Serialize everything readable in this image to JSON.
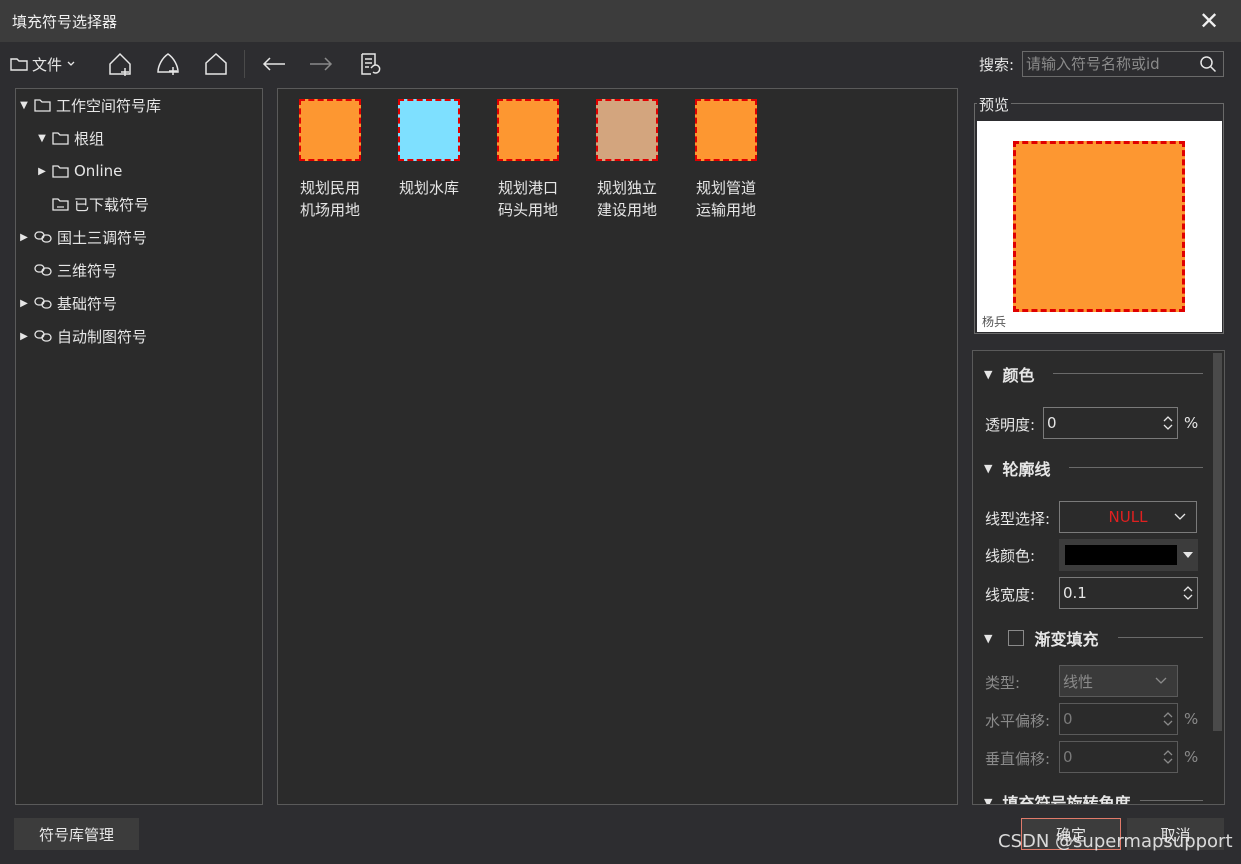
{
  "window": {
    "title": "填充符号选择器",
    "close_label": "✕"
  },
  "toolbar": {
    "file_label": "文件",
    "search_label": "搜索:",
    "search_placeholder": "请输入符号名称或id"
  },
  "tree": {
    "items": [
      {
        "label": "工作空间符号库",
        "expanded": true,
        "icon": "folder-icon"
      },
      {
        "label": "根组",
        "expanded": true,
        "icon": "folder-icon"
      },
      {
        "label": "Online",
        "expanded": false,
        "icon": "folder-icon"
      },
      {
        "label": "已下载符号",
        "icon": "folder-icon"
      },
      {
        "label": "国土三调符号",
        "expanded": false,
        "icon": "link-icon"
      },
      {
        "label": "三维符号",
        "icon": "link-icon"
      },
      {
        "label": "基础符号",
        "expanded": false,
        "icon": "link-icon"
      },
      {
        "label": "自动制图符号",
        "expanded": false,
        "icon": "link-icon"
      }
    ]
  },
  "symbols": [
    {
      "label": "规划民用机场用地",
      "color": "#fd9731"
    },
    {
      "label": "规划水库",
      "color": "#7ee0ff"
    },
    {
      "label": "规划港口码头用地",
      "color": "#fd9731"
    },
    {
      "label": "规划独立建设用地",
      "color": "#d3a57e"
    },
    {
      "label": "规划管道运输用地",
      "color": "#fd9731"
    }
  ],
  "preview": {
    "title": "预览",
    "credit": "杨兵",
    "fill_color": "#fd9731",
    "border_color": "#e00000"
  },
  "properties": {
    "color_section": "颜色",
    "transparency_label": "透明度:",
    "transparency_value": "0",
    "percent": "%",
    "outline_section": "轮廓线",
    "line_type_label": "线型选择:",
    "line_type_value": "NULL",
    "line_color_label": "线颜色:",
    "line_color_value": "#000000",
    "line_width_label": "线宽度:",
    "line_width_value": "0.1",
    "gradient_section": "渐变填充",
    "gradient_checked": false,
    "type_label": "类型:",
    "type_value": "线性",
    "h_offset_label": "水平偏移:",
    "h_offset_value": "0",
    "v_offset_label": "垂直偏移:",
    "v_offset_value": "0",
    "rotation_section": "填充符号旋转角度"
  },
  "footer": {
    "library_button": "符号库管理",
    "ok_button": "确定",
    "cancel_button": "取消",
    "watermark": "CSDN @supermapsupport"
  },
  "colors": {
    "accent_red": "#e00000",
    "ok_border": "#e07a6a",
    "null_text": "#e02020"
  }
}
